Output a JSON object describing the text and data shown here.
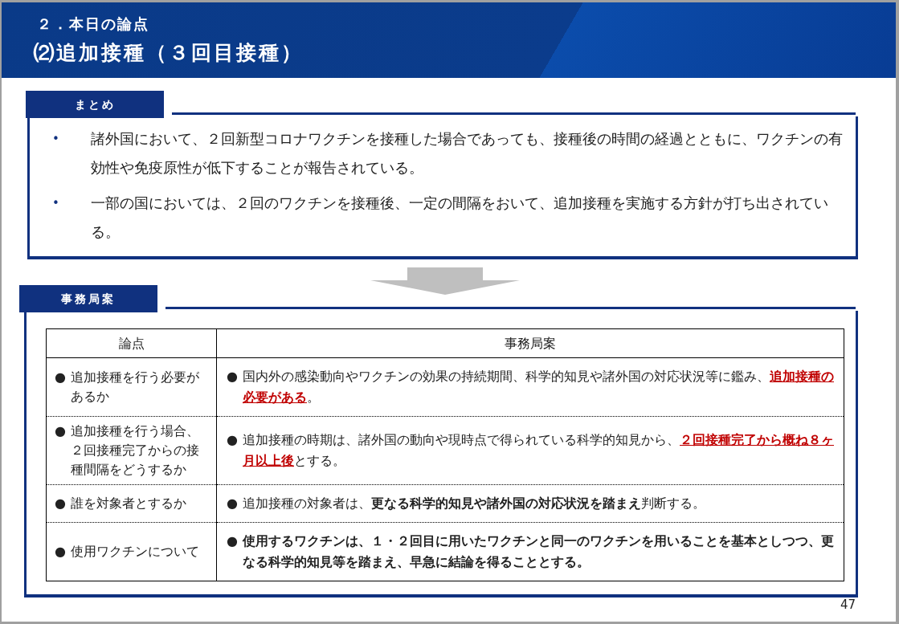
{
  "header": {
    "section": "２．本日の論点",
    "title": "⑵追加接種（３回目接種）"
  },
  "summary": {
    "label": "まとめ",
    "items": [
      {
        "marker": "•",
        "text": "諸外国において、２回新型コロナワクチンを接種した場合であっても、接種後の時間の経過とともに、ワクチンの有効性や免疫原性が低下することが報告されている。"
      },
      {
        "marker": "•",
        "text": "一部の国においては、２回のワクチンを接種後、一定の間隔をおいて、追加接種を実施する方針が打ち出されている。"
      }
    ]
  },
  "proposal": {
    "label": "事務局案",
    "table": {
      "columns": [
        "論点",
        "事務局案"
      ],
      "rows": [
        {
          "issue": {
            "marker": "●",
            "text": "追加接種を行う必要があるか"
          },
          "answer": {
            "marker": "●",
            "segments": [
              {
                "kind": "plain",
                "text": "国内外の感染動向やワクチンの効果の持続期間、科学的知見や諸外国の対応状況等に鑑み、"
              },
              {
                "kind": "red",
                "text": "追加接種の必要がある"
              },
              {
                "kind": "plain",
                "text": "。"
              }
            ]
          }
        },
        {
          "issue": {
            "marker": "●",
            "text": "追加接種を行う場合、２回接種完了からの接種間隔をどうするか"
          },
          "answer": {
            "marker": "●",
            "segments": [
              {
                "kind": "plain",
                "text": "追加接種の時期は、諸外国の動向や現時点で得られている科学的知見から、"
              },
              {
                "kind": "red",
                "text": "２回接種完了から概ね８ヶ月以上後"
              },
              {
                "kind": "plain",
                "text": "とする。"
              }
            ]
          }
        },
        {
          "issue": {
            "marker": "●",
            "text": "誰を対象者とするか"
          },
          "answer": {
            "marker": "●",
            "segments": [
              {
                "kind": "plain",
                "text": "追加接種の対象者は、"
              },
              {
                "kind": "bold",
                "text": "更なる科学的知見や諸外国の対応状況を踏まえ"
              },
              {
                "kind": "plain",
                "text": "判断する。"
              }
            ]
          }
        },
        {
          "issue": {
            "marker": "●",
            "text": "使用ワクチンについて"
          },
          "answer": {
            "marker": "●",
            "segments": [
              {
                "kind": "bold",
                "text": "使用するワクチンは、１・２回目に用いたワクチンと同一のワクチンを用いることを基本としつつ、更なる科学的知見等を踏まえ、早急に結論を得ることとする。"
              }
            ]
          }
        }
      ]
    }
  },
  "page_number": "47"
}
